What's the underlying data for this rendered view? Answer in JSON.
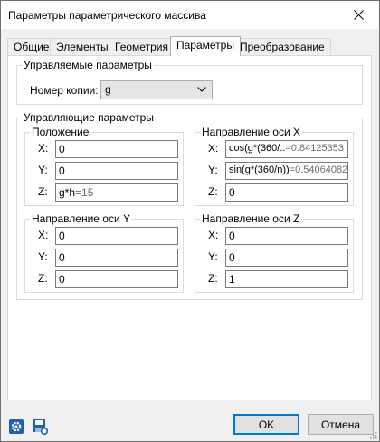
{
  "window": {
    "title": "Параметры параметрического массива",
    "close_glyph": "✕"
  },
  "tabs": [
    {
      "label": "Общие",
      "active": false
    },
    {
      "label": "Элементы",
      "active": false
    },
    {
      "label": "Геометрия",
      "active": false
    },
    {
      "label": "Параметры",
      "active": true
    },
    {
      "label": "Преобразование",
      "active": false
    }
  ],
  "controlled": {
    "title": "Управляемые параметры",
    "copy_number_label": "Номер копии:",
    "copy_number_value": "g"
  },
  "controlling": {
    "title": "Управляющие параметры",
    "position": {
      "title": "Положение",
      "x_label": "X:",
      "x_value": "0",
      "y_label": "Y:",
      "y_value": "0",
      "z_label": "Z:",
      "z_expr": "g*h",
      "z_result": "=15"
    },
    "axis_x": {
      "title": "Направление оси X",
      "x_label": "X:",
      "x_expr": "cos(g*(360/..",
      "x_result": "=0.84125353",
      "y_label": "Y:",
      "y_expr": "sin(g*(360/n))",
      "y_result": "=0.54064082",
      "z_label": "Z:",
      "z_value": "0"
    },
    "axis_y": {
      "title": "Направление оси Y",
      "x_label": "X:",
      "x_value": "0",
      "y_label": "Y:",
      "y_value": "0",
      "z_label": "Z:",
      "z_value": "0"
    },
    "axis_z": {
      "title": "Направление оси Z",
      "x_label": "X:",
      "x_value": "0",
      "y_label": "Y:",
      "y_value": "0",
      "z_label": "Z:",
      "z_value": "1"
    }
  },
  "buttons": {
    "ok": "OK",
    "cancel": "Отмена"
  },
  "icons": {
    "settings": "gear-icon",
    "save": "save-settings-icon"
  },
  "colors": {
    "accent": "#0078d7",
    "icon_blue": "#1f5fae"
  }
}
